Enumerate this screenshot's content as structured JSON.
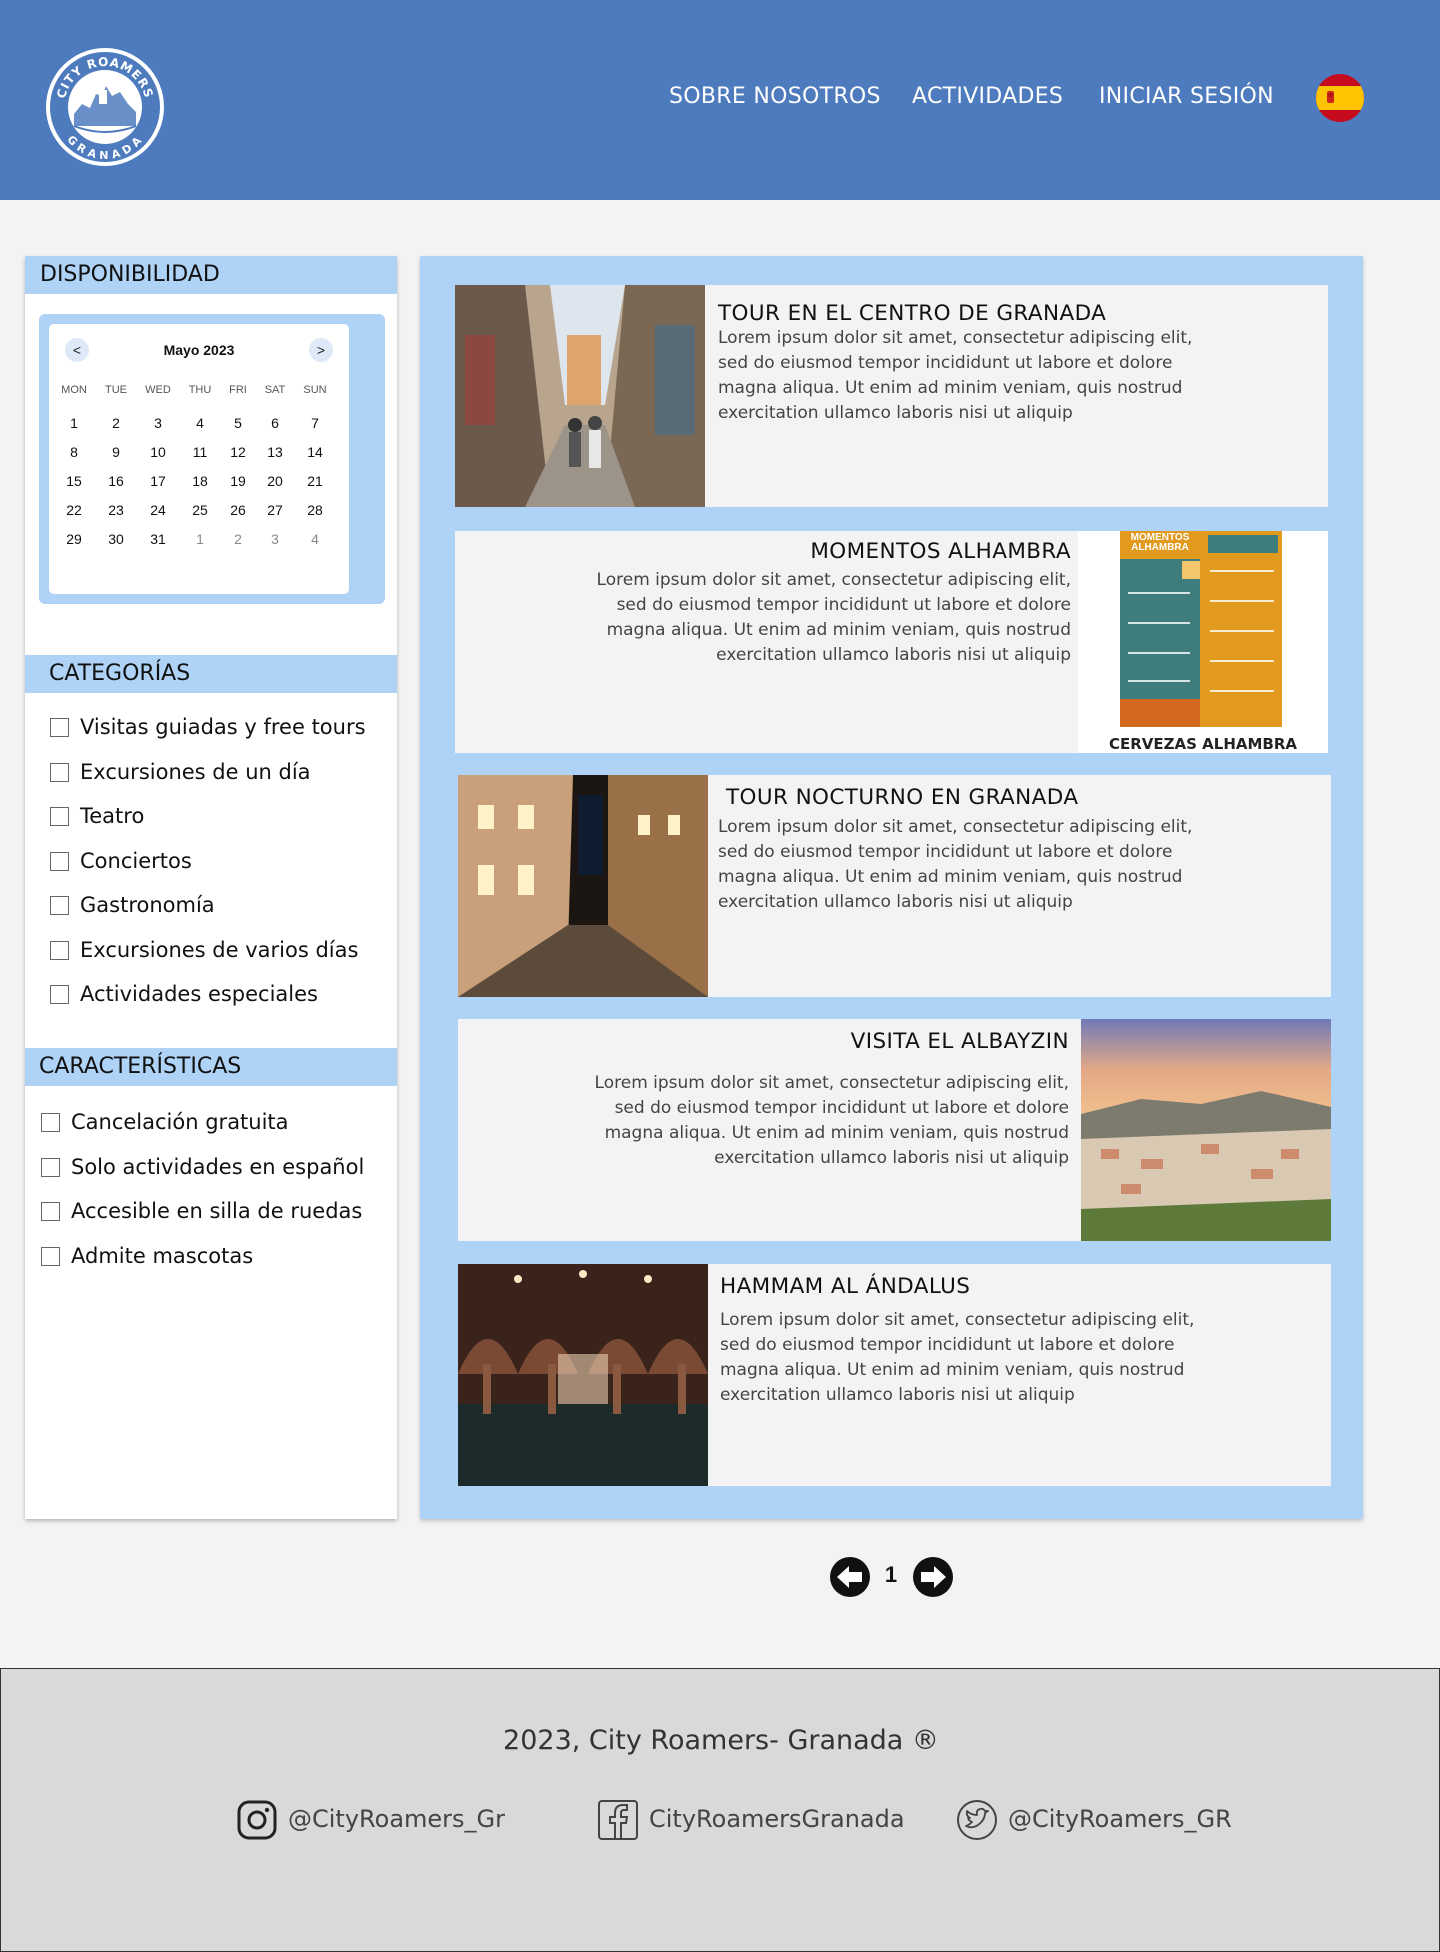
{
  "header": {
    "logo_text_top": "CITY ROAMERS",
    "logo_text_bottom": "GRANADA",
    "nav": [
      "SOBRE NOSOTROS",
      "ACTIVIDADES",
      "INICIAR SESIÓN"
    ],
    "language_flag": "spain-flag-icon",
    "background_color": "#4d7bbd"
  },
  "sidebar": {
    "availability_title": "DISPONIBILIDAD",
    "calendar": {
      "month_label": "Mayo 2023",
      "prev_label": "<",
      "next_label": ">",
      "weekdays": [
        "MON",
        "TUE",
        "WED",
        "THU",
        "FRI",
        "SAT",
        "SUN"
      ],
      "weeks": [
        [
          "1",
          "2",
          "3",
          "4",
          "5",
          "6",
          "7"
        ],
        [
          "8",
          "9",
          "10",
          "11",
          "12",
          "13",
          "14"
        ],
        [
          "15",
          "16",
          "17",
          "18",
          "19",
          "20",
          "21"
        ],
        [
          "22",
          "23",
          "24",
          "25",
          "26",
          "27",
          "28"
        ],
        [
          "29",
          "30",
          "31",
          "1",
          "2",
          "3",
          "4"
        ]
      ]
    },
    "categories_title": "CATEGORÍAS",
    "categories": [
      "Visitas guiadas y free tours",
      "Excursiones de un día",
      "Teatro",
      "Conciertos",
      "Gastronomía",
      "Excursiones de varios días",
      "Actividades especiales"
    ],
    "features_title": "CARACTERÍSTICAS",
    "features": [
      "Cancelación gratuita",
      "Solo actividades en español",
      "Accesible en silla de ruedas",
      "Admite mascotas"
    ],
    "accent_color": "#aed3f7"
  },
  "activities": [
    {
      "title": "TOUR EN EL CENTRO DE GRANADA",
      "description": "Lorem ipsum dolor sit amet, consectetur adipiscing elit, sed do eiusmod tempor incididunt ut labore et dolore magna aliqua. Ut enim ad minim veniam, quis nostrud exercitation ullamco laboris nisi ut aliquip",
      "image": "street-photo"
    },
    {
      "title": "MOMENTOS ALHAMBRA",
      "description": "Lorem ipsum dolor sit amet, consectetur adipiscing elit, sed do eiusmod tempor incididunt ut labore et dolore magna aliqua. Ut enim ad minim veniam, quis nostrud exercitation ullamco laboris nisi ut aliquip",
      "image": "poster",
      "poster_title": "MOMENTOS ALHAMBRA",
      "poster_footer": "CERVEZAS ALHAMBRA"
    },
    {
      "title": "TOUR NOCTURNO EN GRANADA",
      "description": "Lorem ipsum dolor sit amet, consectetur adipiscing elit, sed do eiusmod tempor incididunt ut labore et dolore magna aliqua. Ut enim ad minim veniam, quis nostrud exercitation ullamco laboris nisi ut aliquip",
      "image": "night-street-photo"
    },
    {
      "title": "VISITA EL ALBAYZIN",
      "description": "Lorem ipsum dolor sit amet, consectetur adipiscing elit, sed do eiusmod tempor incididunt ut labore et dolore magna aliqua. Ut enim ad minim veniam, quis nostrud exercitation ullamco laboris nisi ut aliquip",
      "image": "albaicin-panorama-photo"
    },
    {
      "title": "HAMMAM AL ÁNDALUS",
      "description": "Lorem ipsum dolor sit amet, consectetur adipiscing elit, sed do eiusmod tempor incididunt ut labore et dolore magna aliqua. Ut enim ad minim veniam, quis nostrud exercitation ullamco laboris nisi ut aliquip",
      "image": "hammam-photo"
    }
  ],
  "pagination": {
    "current_page": "1"
  },
  "footer": {
    "copyright": "2023, City Roamers- Granada ®",
    "social": [
      {
        "icon": "instagram-icon",
        "label": "@CityRoamers_Gr"
      },
      {
        "icon": "facebook-icon",
        "label": "CityRoamersGranada"
      },
      {
        "icon": "twitter-icon",
        "label": "@CityRoamers_GR"
      }
    ]
  }
}
